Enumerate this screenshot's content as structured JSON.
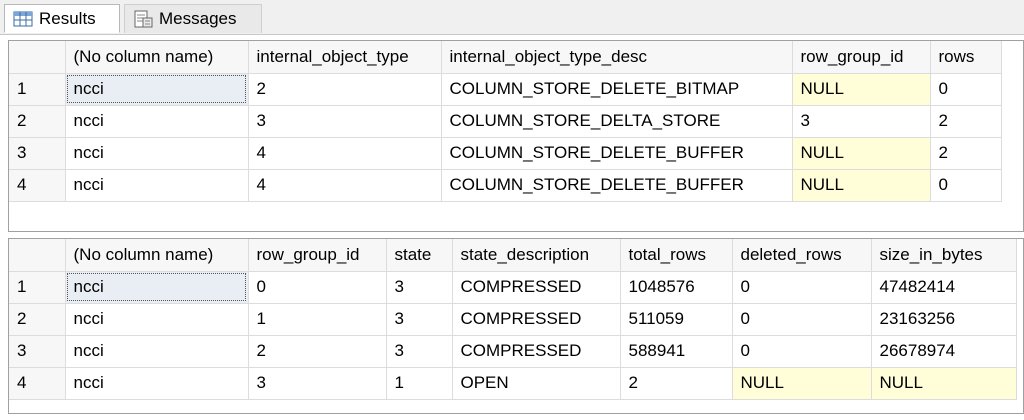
{
  "tabs": [
    {
      "label": "Results",
      "icon": "grid-icon",
      "active": true
    },
    {
      "label": "Messages",
      "icon": "messages-icon",
      "active": false
    }
  ],
  "grid1": {
    "columns": [
      "(No column name)",
      "internal_object_type",
      "internal_object_type_desc",
      "row_group_id",
      "rows"
    ],
    "rows": [
      {
        "num": "1",
        "cells": [
          "ncci",
          "2",
          "COLUMN_STORE_DELETE_BITMAP",
          "NULL",
          "0"
        ]
      },
      {
        "num": "2",
        "cells": [
          "ncci",
          "3",
          "COLUMN_STORE_DELTA_STORE",
          "3",
          "2"
        ]
      },
      {
        "num": "3",
        "cells": [
          "ncci",
          "4",
          "COLUMN_STORE_DELETE_BUFFER",
          "NULL",
          "2"
        ]
      },
      {
        "num": "4",
        "cells": [
          "ncci",
          "4",
          "COLUMN_STORE_DELETE_BUFFER",
          "NULL",
          "0"
        ]
      }
    ]
  },
  "grid2": {
    "columns": [
      "(No column name)",
      "row_group_id",
      "state",
      "state_description",
      "total_rows",
      "deleted_rows",
      "size_in_bytes"
    ],
    "rows": [
      {
        "num": "1",
        "cells": [
          "ncci",
          "0",
          "3",
          "COMPRESSED",
          "1048576",
          "0",
          "47482414"
        ]
      },
      {
        "num": "2",
        "cells": [
          "ncci",
          "1",
          "3",
          "COMPRESSED",
          "511059",
          "0",
          "23163256"
        ]
      },
      {
        "num": "3",
        "cells": [
          "ncci",
          "2",
          "3",
          "COMPRESSED",
          "588941",
          "0",
          "26678974"
        ]
      },
      {
        "num": "4",
        "cells": [
          "ncci",
          "3",
          "1",
          "OPEN",
          "2",
          "NULL",
          "NULL"
        ]
      }
    ]
  },
  "colors": {
    "null_cell": "#fffed9",
    "selected_cell": "#e8eef4",
    "header": "#f7f7f7"
  }
}
